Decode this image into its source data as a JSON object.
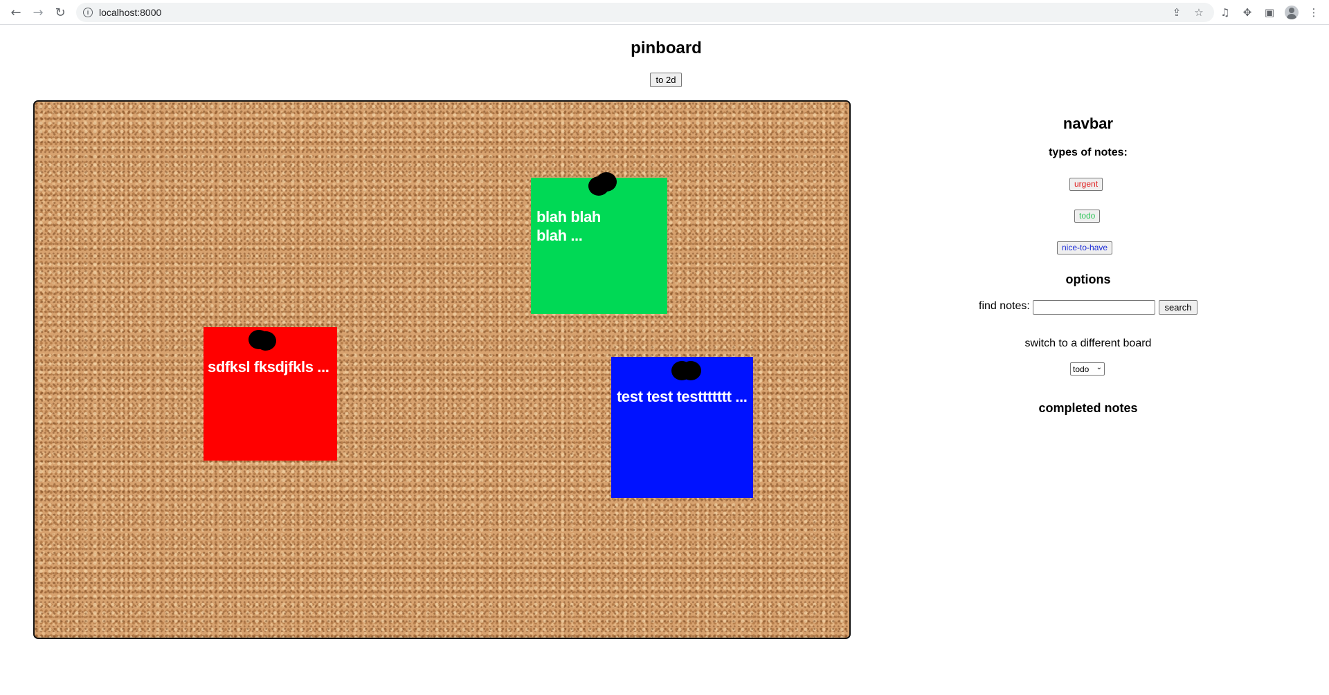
{
  "browser": {
    "url": "localhost:8000",
    "icons": [
      "back-arrow-icon",
      "forward-arrow-icon",
      "reload-icon",
      "info-icon",
      "share-icon",
      "star-icon",
      "media-icon",
      "extensions-icon",
      "side-panel-icon",
      "profile-icon",
      "menu-icon"
    ]
  },
  "page": {
    "title": "pinboard",
    "toggle_label": "to 2d"
  },
  "board": {
    "notes": [
      {
        "type": "todo",
        "color": "#00d955",
        "text_line1": "blah blah",
        "text_line2": "blah ..."
      },
      {
        "type": "urgent",
        "color": "#ff0000",
        "text": "sdfksl fksdjfkls  ..."
      },
      {
        "type": "nice-to-have",
        "color": "#0012ff",
        "text": "test test testtttttt ..."
      }
    ]
  },
  "navbar": {
    "title": "navbar",
    "types_heading": "types of notes:",
    "types": [
      {
        "label": "urgent",
        "color": "#e02020"
      },
      {
        "label": "todo",
        "color": "#2fc55a"
      },
      {
        "label": "nice-to-have",
        "color": "#1a2ad8"
      }
    ],
    "options_heading": "options",
    "find_label": "find notes:",
    "find_value": "",
    "search_label": "search",
    "switch_label": "switch to a different board",
    "board_select_value": "todo",
    "completed_heading": "completed notes"
  }
}
